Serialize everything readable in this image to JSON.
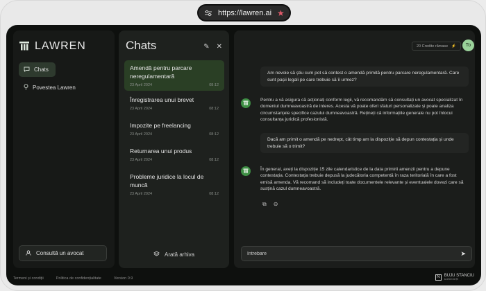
{
  "browser": {
    "url": "https://lawren.ai"
  },
  "sidebar": {
    "logo": "LAWREN",
    "items": [
      {
        "label": "Chats",
        "icon": "chat-bubble-icon"
      },
      {
        "label": "Povestea Lawren",
        "icon": "lightbulb-icon"
      }
    ],
    "consult_label": "Consultă un avocat"
  },
  "chats": {
    "title": "Chats",
    "items": [
      {
        "title": "Amendă pentru parcare neregulamentară",
        "date": "23 April 2024",
        "time": "08:12"
      },
      {
        "title": "Înregistrarea unui brevet",
        "date": "23 April 2024",
        "time": "08:12"
      },
      {
        "title": "Impozite pe freelancing",
        "date": "23 April 2024",
        "time": "08:12"
      },
      {
        "title": "Returnarea unui produs",
        "date": "23 April 2024",
        "time": "08:12"
      },
      {
        "title": "Probleme juridice la locul de muncă",
        "date": "23 April 2024",
        "time": "08:12"
      }
    ],
    "archive_label": "Arată arhiva"
  },
  "conversation": {
    "credits": "20 Credite rămase",
    "avatar": "To",
    "messages": [
      {
        "role": "user",
        "text": "Am nevoie să știu cum pot să contest o amendă primită pentru parcare neregulamentară. Care sunt pașii legali pe care trebuie să îi urmez?"
      },
      {
        "role": "assistant",
        "text": "Pentru a vă asigura că acționați conform legii, vă recomandăm să consultați un avocat specializat în domeniul dumneavoastră de interes. Acesta vă poate oferi sfaturi personalizate și poate analiza circumstanțele specifice cazului dumneavoastră. Rețineți că informațiile generale nu pot înlocui consultanța juridică profesionistă."
      },
      {
        "role": "user",
        "text": "Dacă am primit o amendă pe nedrept, cât timp am la dispoziție să depun contestația și unde trebuie să o trimit?"
      },
      {
        "role": "assistant",
        "text": "În general, aveți la dispoziție 15 zile calendaristice de la data primirii amenzii pentru a depune contestația. Contestația trebuie depusă la judecătoria competentă în raza teritorială în care a fost emisă amenda. Vă recomand să includeți toate documentele relevante și eventualele dovezi care să susțină cazul dumneavoastră."
      }
    ],
    "input_placeholder": "Întrebare"
  },
  "footer": {
    "links": [
      "Termeni și condiții",
      "Politica de confidențialitate"
    ],
    "version": "Version 0.9",
    "brand": "BUJU STANCIU",
    "brand_sub": "& ASOCIAȚII"
  }
}
